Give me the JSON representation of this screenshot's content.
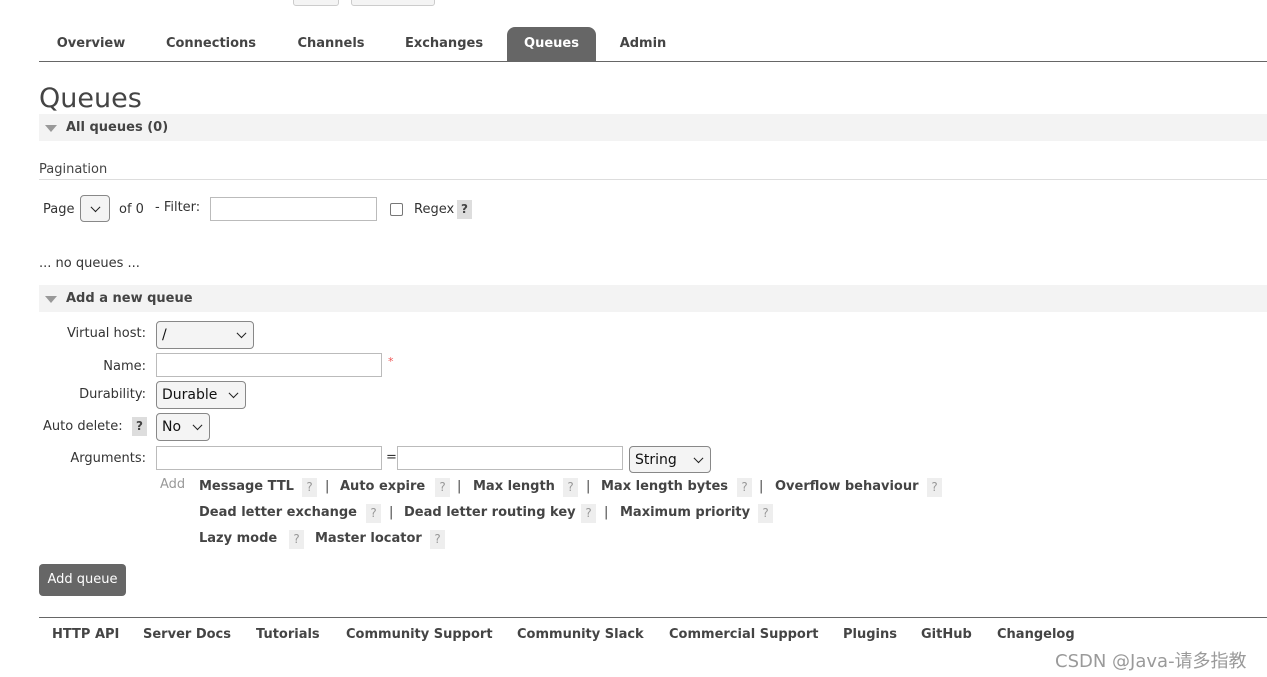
{
  "nav": {
    "tabs": [
      "Overview",
      "Connections",
      "Channels",
      "Exchanges",
      "Queues",
      "Admin"
    ],
    "active": "Queues"
  },
  "page_title": "Queues",
  "all_queues": {
    "label": "All queues (0)"
  },
  "pagination": {
    "heading": "Pagination",
    "page_label": "Page",
    "of_label": "of 0",
    "filter_label": "- Filter:",
    "filter_value": "",
    "regex_label": "Regex",
    "help": "?"
  },
  "no_queues": "... no queues ...",
  "add_queue": {
    "heading": "Add a new queue",
    "virtual_host_label": "Virtual host:",
    "virtual_host_value": "/",
    "name_label": "Name:",
    "name_value": "",
    "required_mark": "*",
    "durability_label": "Durability:",
    "durability_value": "Durable",
    "auto_delete_label": "Auto delete:",
    "auto_delete_value": "No",
    "arguments_label": "Arguments:",
    "equals": "=",
    "arg_type": "String",
    "add_label": "Add",
    "help": "?",
    "separator": "|",
    "arg_links": [
      "Message TTL",
      "Auto expire",
      "Max length",
      "Max length bytes",
      "Overflow behaviour",
      "Dead letter exchange",
      "Dead letter routing key",
      "Maximum priority",
      "Lazy mode",
      "Master locator"
    ],
    "submit_label": "Add queue"
  },
  "footer": {
    "links": [
      "HTTP API",
      "Server Docs",
      "Tutorials",
      "Community Support",
      "Community Slack",
      "Commercial Support",
      "Plugins",
      "GitHub",
      "Changelog"
    ]
  },
  "watermark": "CSDN @Java-请多指教"
}
